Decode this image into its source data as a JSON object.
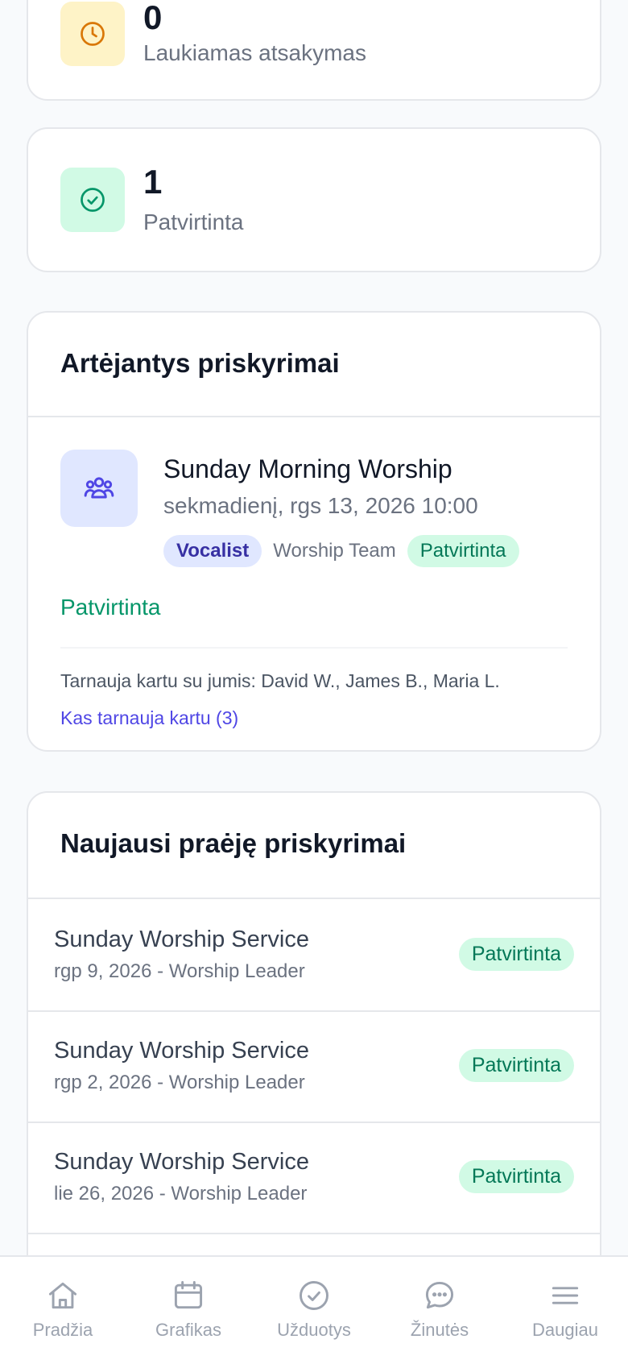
{
  "stats": [
    {
      "number": "0",
      "label": "Laukiamas atsakymas",
      "icon": "clock-icon",
      "color": "#d97706",
      "bg": "#fef3c7"
    },
    {
      "number": "1",
      "label": "Patvirtinta",
      "icon": "check-circle-icon",
      "color": "#059669",
      "bg": "#d1fae5"
    }
  ],
  "upcoming": {
    "title": "Artėjantys priskyrimai",
    "item": {
      "event": "Sunday Morning Worship",
      "datetime": "sekmadienį, rgs 13, 2026 10:00",
      "role": "Vocalist",
      "team": "Worship Team",
      "status_badge": "Patvirtinta",
      "status_text": "Patvirtinta",
      "serving_with": "Tarnauja kartu su jumis: David W., James B., Maria L.",
      "serving_link": "Kas tarnauja kartu (3)"
    }
  },
  "past": {
    "title": "Naujausi praėję priskyrimai",
    "items": [
      {
        "title": "Sunday Worship Service",
        "sub": "rgp 9, 2026 - Worship Leader",
        "status": "Patvirtinta"
      },
      {
        "title": "Sunday Worship Service",
        "sub": "rgp 2, 2026 - Worship Leader",
        "status": "Patvirtinta"
      },
      {
        "title": "Sunday Worship Service",
        "sub": "lie 26, 2026 - Worship Leader",
        "status": "Patvirtinta"
      }
    ]
  },
  "nav": [
    {
      "label": "Pradžia",
      "icon": "home-icon"
    },
    {
      "label": "Grafikas",
      "icon": "calendar-icon"
    },
    {
      "label": "Užduotys",
      "icon": "check-circle-icon"
    },
    {
      "label": "Žinutės",
      "icon": "chat-icon"
    },
    {
      "label": "Daugiau",
      "icon": "menu-icon"
    }
  ]
}
